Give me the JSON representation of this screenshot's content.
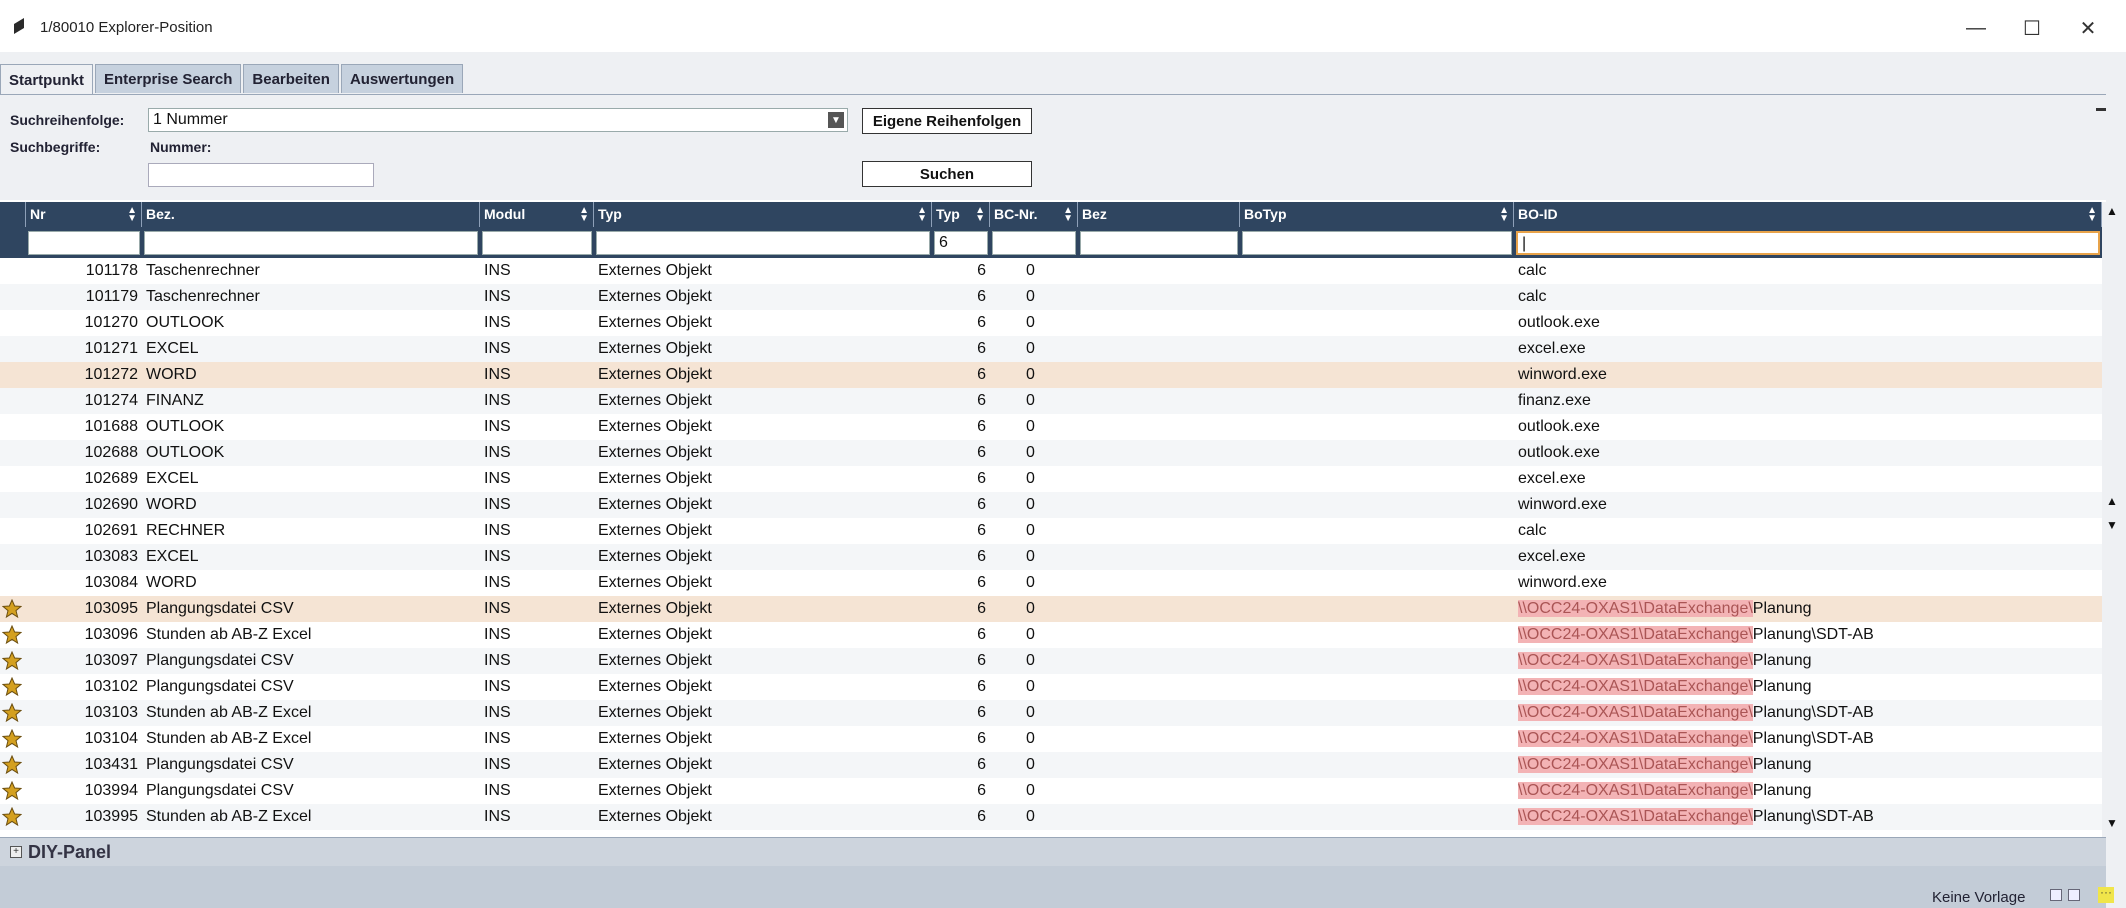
{
  "window": {
    "title": "1/80010 Explorer-Position",
    "minimize": "—",
    "maximize": "☐",
    "close": "✕"
  },
  "tabs": [
    {
      "label": "Startpunkt"
    },
    {
      "label": "Enterprise Search"
    },
    {
      "label": "Bearbeiten"
    },
    {
      "label": "Auswertungen"
    }
  ],
  "search": {
    "order_label": "Suchreihenfolge:",
    "order_value": "1 Nummer",
    "custom_order_button": "Eigene Reihenfolgen",
    "terms_label": "Suchbegriffe:",
    "number_label": "Nummer:",
    "number_value": "",
    "search_button": "Suchen"
  },
  "grid": {
    "columns": [
      {
        "label": "Nr",
        "filter": ""
      },
      {
        "label": "Bez.",
        "filter": ""
      },
      {
        "label": "Modul",
        "filter": ""
      },
      {
        "label": "Typ",
        "filter": ""
      },
      {
        "label": "Typ",
        "filter": "6"
      },
      {
        "label": "BC-Nr.",
        "filter": ""
      },
      {
        "label": "Bez",
        "filter": ""
      },
      {
        "label": "BoTyp",
        "filter": ""
      },
      {
        "label": "BO-ID",
        "filter": "|"
      }
    ],
    "rows": [
      {
        "nr": "101178",
        "bez": "Taschenrechner",
        "modul": "INS",
        "typ": "Externes Objekt",
        "typnr": "6",
        "bc": "0",
        "boid": "calc",
        "boid_hl": "",
        "starred": false
      },
      {
        "nr": "101179",
        "bez": "Taschenrechner",
        "modul": "INS",
        "typ": "Externes Objekt",
        "typnr": "6",
        "bc": "0",
        "boid": "calc",
        "boid_hl": "",
        "starred": false
      },
      {
        "nr": "101270",
        "bez": "OUTLOOK",
        "modul": "INS",
        "typ": "Externes Objekt",
        "typnr": "6",
        "bc": "0",
        "boid": "outlook.exe",
        "boid_hl": "",
        "starred": false
      },
      {
        "nr": "101271",
        "bez": "EXCEL",
        "modul": "INS",
        "typ": "Externes Objekt",
        "typnr": "6",
        "bc": "0",
        "boid": "excel.exe",
        "boid_hl": "",
        "starred": false
      },
      {
        "nr": "101272",
        "bez": "WORD",
        "modul": "INS",
        "typ": "Externes Objekt",
        "typnr": "6",
        "bc": "0",
        "boid": "winword.exe",
        "boid_hl": "",
        "starred": false
      },
      {
        "nr": "101274",
        "bez": "FINANZ",
        "modul": "INS",
        "typ": "Externes Objekt",
        "typnr": "6",
        "bc": "0",
        "boid": "finanz.exe",
        "boid_hl": "",
        "starred": false
      },
      {
        "nr": "101688",
        "bez": "OUTLOOK",
        "modul": "INS",
        "typ": "Externes Objekt",
        "typnr": "6",
        "bc": "0",
        "boid": "outlook.exe",
        "boid_hl": "",
        "starred": false
      },
      {
        "nr": "102688",
        "bez": "OUTLOOK",
        "modul": "INS",
        "typ": "Externes Objekt",
        "typnr": "6",
        "bc": "0",
        "boid": "outlook.exe",
        "boid_hl": "",
        "starred": false
      },
      {
        "nr": "102689",
        "bez": "EXCEL",
        "modul": "INS",
        "typ": "Externes Objekt",
        "typnr": "6",
        "bc": "0",
        "boid": "excel.exe",
        "boid_hl": "",
        "starred": false
      },
      {
        "nr": "102690",
        "bez": "WORD",
        "modul": "INS",
        "typ": "Externes Objekt",
        "typnr": "6",
        "bc": "0",
        "boid": "winword.exe",
        "boid_hl": "",
        "starred": false
      },
      {
        "nr": "102691",
        "bez": "RECHNER",
        "modul": "INS",
        "typ": "Externes Objekt",
        "typnr": "6",
        "bc": "0",
        "boid": "calc",
        "boid_hl": "",
        "starred": false
      },
      {
        "nr": "103083",
        "bez": "EXCEL",
        "modul": "INS",
        "typ": "Externes Objekt",
        "typnr": "6",
        "bc": "0",
        "boid": "excel.exe",
        "boid_hl": "",
        "starred": false
      },
      {
        "nr": "103084",
        "bez": "WORD",
        "modul": "INS",
        "typ": "Externes Objekt",
        "typnr": "6",
        "bc": "0",
        "boid": "winword.exe",
        "boid_hl": "",
        "starred": false
      },
      {
        "nr": "103095",
        "bez": "Plangungsdatei CSV",
        "modul": "INS",
        "typ": "Externes Objekt",
        "typnr": "6",
        "bc": "0",
        "boid_hl": "\\\\OCC24-OXAS1\\DataExchange\\",
        "boid": "Planung",
        "starred": true
      },
      {
        "nr": "103096",
        "bez": "Stunden ab AB-Z Excel",
        "modul": "INS",
        "typ": "Externes Objekt",
        "typnr": "6",
        "bc": "0",
        "boid_hl": "\\\\OCC24-OXAS1\\DataExchange\\",
        "boid": "Planung\\SDT-AB",
        "starred": true
      },
      {
        "nr": "103097",
        "bez": "Plangungsdatei CSV",
        "modul": "INS",
        "typ": "Externes Objekt",
        "typnr": "6",
        "bc": "0",
        "boid_hl": "\\\\OCC24-OXAS1\\DataExchange\\",
        "boid": "Planung",
        "starred": true
      },
      {
        "nr": "103102",
        "bez": "Plangungsdatei CSV",
        "modul": "INS",
        "typ": "Externes Objekt",
        "typnr": "6",
        "bc": "0",
        "boid_hl": "\\\\OCC24-OXAS1\\DataExchange\\",
        "boid": "Planung",
        "starred": true
      },
      {
        "nr": "103103",
        "bez": "Stunden ab AB-Z Excel",
        "modul": "INS",
        "typ": "Externes Objekt",
        "typnr": "6",
        "bc": "0",
        "boid_hl": "\\\\OCC24-OXAS1\\DataExchange\\",
        "boid": "Planung\\SDT-AB",
        "starred": true
      },
      {
        "nr": "103104",
        "bez": "Stunden ab AB-Z Excel",
        "modul": "INS",
        "typ": "Externes Objekt",
        "typnr": "6",
        "bc": "0",
        "boid_hl": "\\\\OCC24-OXAS1\\DataExchange\\",
        "boid": "Planung\\SDT-AB",
        "starred": true
      },
      {
        "nr": "103431",
        "bez": "Plangungsdatei CSV",
        "modul": "INS",
        "typ": "Externes Objekt",
        "typnr": "6",
        "bc": "0",
        "boid_hl": "\\\\OCC24-OXAS1\\DataExchange\\",
        "boid": "Planung",
        "starred": true
      },
      {
        "nr": "103994",
        "bez": "Plangungsdatei CSV",
        "modul": "INS",
        "typ": "Externes Objekt",
        "typnr": "6",
        "bc": "0",
        "boid_hl": "\\\\OCC24-OXAS1\\DataExchange\\",
        "boid": "Planung",
        "starred": true
      },
      {
        "nr": "103995",
        "bez": "Stunden ab AB-Z Excel",
        "modul": "INS",
        "typ": "Externes Objekt",
        "typnr": "6",
        "bc": "0",
        "boid_hl": "\\\\OCC24-OXAS1\\DataExchange\\",
        "boid": "Planung\\SDT-AB",
        "starred": true
      }
    ],
    "selected_rows": [
      4,
      13
    ]
  },
  "diy_panel": {
    "title": "DIY-Panel"
  },
  "status": {
    "template": "Keine Vorlage",
    "more": "···"
  },
  "colors": {
    "header_bg": "#2f4560",
    "selected_row": "#f5e4d4",
    "path_highlight": "#f3b3b5",
    "star": "#d4a020"
  }
}
